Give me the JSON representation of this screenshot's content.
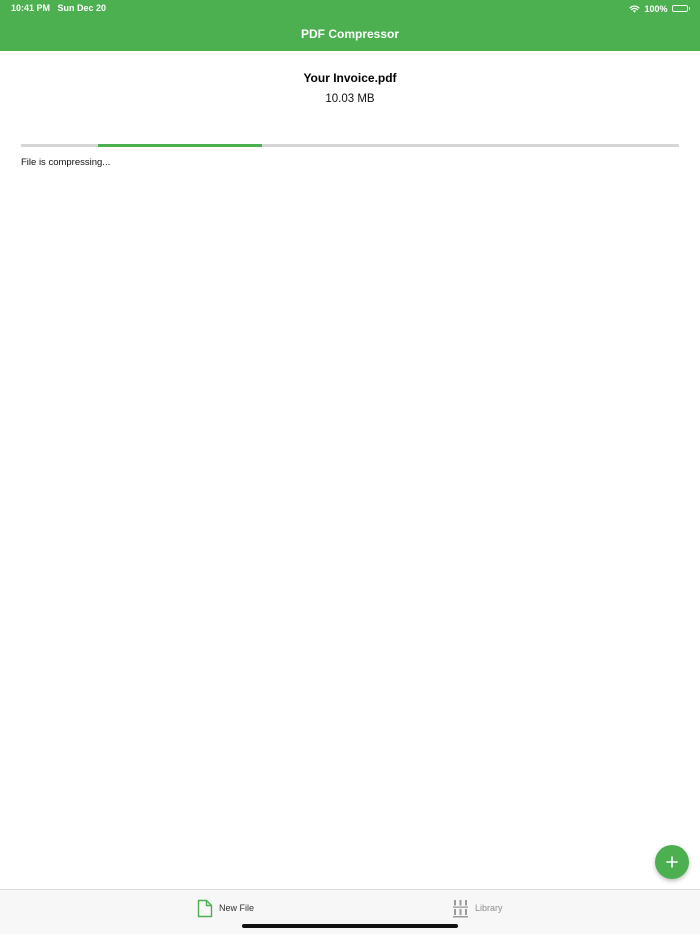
{
  "status_bar": {
    "time": "10:41 PM",
    "date": "Sun Dec 20",
    "battery": "100%",
    "icons": [
      "wifi-icon",
      "battery-icon"
    ]
  },
  "nav": {
    "title": "PDF Compressor"
  },
  "file": {
    "name": "Your Invoice.pdf",
    "size": "10.03 MB"
  },
  "progress": {
    "status_text": "File is compressing...",
    "indeterminate": true,
    "segment_start_fraction": 0.117,
    "segment_end_fraction": 0.367
  },
  "fab": {
    "icon": "plus-icon"
  },
  "tabs": [
    {
      "label": "New File",
      "icon": "document-icon",
      "selected": true
    },
    {
      "label": "Library",
      "icon": "library-icon",
      "selected": false
    }
  ],
  "colors": {
    "accent": "#4caf50",
    "track": "#d6d6d6",
    "tab_bar": "#f7f7f7",
    "tab_inactive": "#8e8e8e"
  }
}
